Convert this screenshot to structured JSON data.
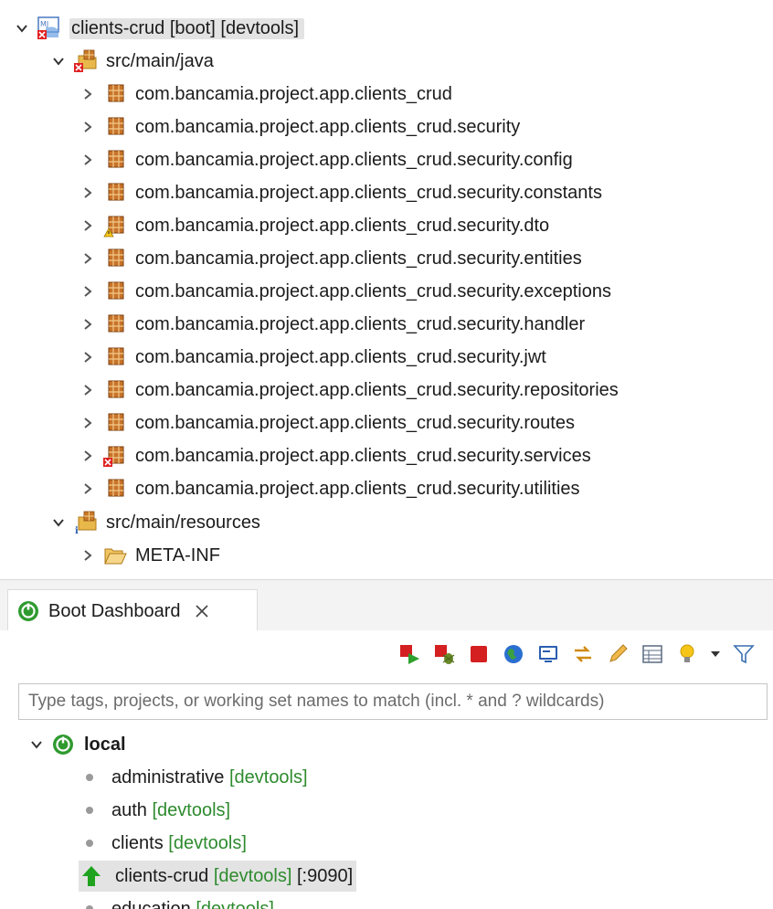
{
  "explorer": {
    "project": {
      "label": "clients-crud [boot] [devtools]",
      "icon": "spring-boot-project-error-icon"
    },
    "src_main_java": {
      "label": "src/main/java",
      "icon": "source-folder-error-icon"
    },
    "packages": [
      {
        "label": "com.bancamia.project.app.clients_crud",
        "icon": "package-icon"
      },
      {
        "label": "com.bancamia.project.app.clients_crud.security",
        "icon": "package-icon"
      },
      {
        "label": "com.bancamia.project.app.clients_crud.security.config",
        "icon": "package-icon"
      },
      {
        "label": "com.bancamia.project.app.clients_crud.security.constants",
        "icon": "package-icon"
      },
      {
        "label": "com.bancamia.project.app.clients_crud.security.dto",
        "icon": "package-warning-icon"
      },
      {
        "label": "com.bancamia.project.app.clients_crud.security.entities",
        "icon": "package-icon"
      },
      {
        "label": "com.bancamia.project.app.clients_crud.security.exceptions",
        "icon": "package-icon"
      },
      {
        "label": "com.bancamia.project.app.clients_crud.security.handler",
        "icon": "package-icon"
      },
      {
        "label": "com.bancamia.project.app.clients_crud.security.jwt",
        "icon": "package-icon"
      },
      {
        "label": "com.bancamia.project.app.clients_crud.security.repositories",
        "icon": "package-icon"
      },
      {
        "label": "com.bancamia.project.app.clients_crud.security.routes",
        "icon": "package-icon"
      },
      {
        "label": "com.bancamia.project.app.clients_crud.security.services",
        "icon": "package-error-icon"
      },
      {
        "label": "com.bancamia.project.app.clients_crud.security.utilities",
        "icon": "package-icon"
      }
    ],
    "src_main_resources": {
      "label": "src/main/resources",
      "icon": "resource-folder-icon"
    },
    "meta_inf": {
      "label": "META-INF",
      "icon": "folder-open-icon"
    }
  },
  "dashboard": {
    "tab_label": "Boot Dashboard",
    "filter_placeholder": "Type tags, projects, or working set names to match (incl. * and ? wildcards)",
    "toolbar": [
      "restart-icon",
      "restart-debug-icon",
      "stop-icon",
      "open-browser-icon",
      "console-icon",
      "expose-icon",
      "edit-icon",
      "properties-icon",
      "lightbulb-icon",
      "dropdown-icon",
      "filter-icon"
    ],
    "local_label": "local",
    "apps": [
      {
        "name": "administrative",
        "tag": "[devtools]",
        "suffix": "",
        "status": "stopped"
      },
      {
        "name": "auth",
        "tag": "[devtools]",
        "suffix": "",
        "status": "stopped"
      },
      {
        "name": "clients",
        "tag": "[devtools]",
        "suffix": "",
        "status": "stopped"
      },
      {
        "name": "clients-crud",
        "tag": "[devtools]",
        "suffix": "[:9090]",
        "status": "running"
      },
      {
        "name": "education",
        "tag": "[devtools]",
        "suffix": "",
        "status": "stopped"
      }
    ],
    "colors": {
      "tag": "#2e8b2e",
      "running_arrow": "#1fa31f",
      "boot_green": "#2f9a2f"
    }
  }
}
